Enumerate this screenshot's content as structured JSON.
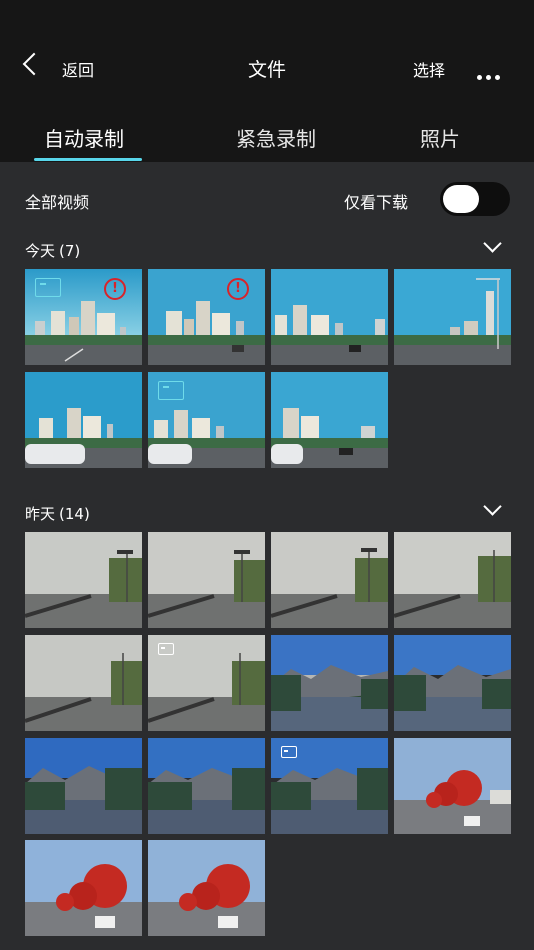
{
  "header": {
    "back_label": "返回",
    "title": "文件",
    "select_label": "选择"
  },
  "tabs": [
    {
      "label": "自动录制",
      "active": true
    },
    {
      "label": "紧急录制",
      "active": false
    },
    {
      "label": "照片",
      "active": false
    }
  ],
  "filter": {
    "all_videos_label": "全部视频",
    "download_only_label": "仅看下载",
    "download_only_on": false
  },
  "sections": [
    {
      "title": "今天",
      "count": "(7)",
      "expanded": true
    },
    {
      "title": "昨天",
      "count": "(14)",
      "expanded": true
    }
  ],
  "colors": {
    "accent": "#58d6ea",
    "alert": "#d8232a",
    "background": "#2b2c2e",
    "header": "#161616"
  }
}
